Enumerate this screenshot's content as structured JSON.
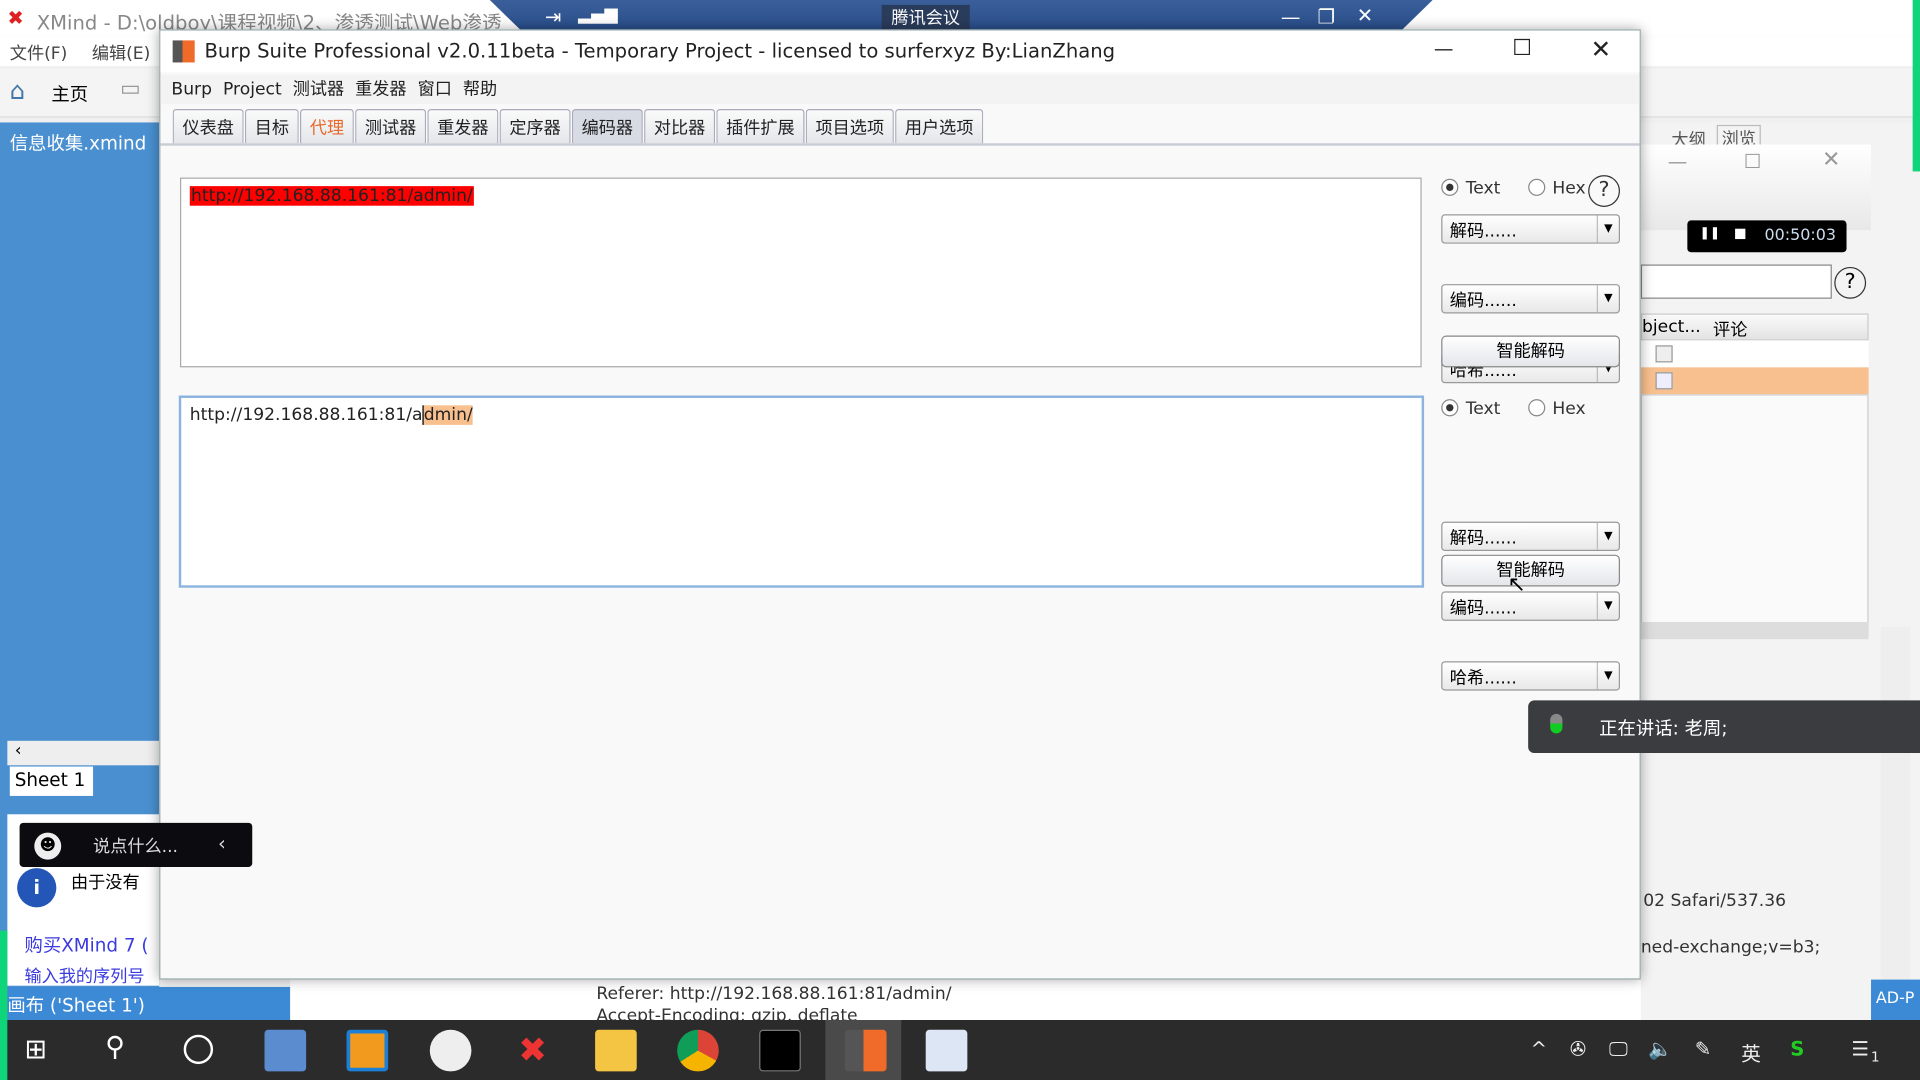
{
  "xmind": {
    "title": "XMind - D:\\oldboy\\课程视频\\2、渗透测试\\Web渗透",
    "menu": [
      "文件(F)",
      "编辑(E)"
    ],
    "home": "主页",
    "file_tab": "信息收集.xmind",
    "sheet_tab": "Sheet 1",
    "status": "画布 ('Sheet 1')",
    "info_text": "由于没有",
    "buy_link": "购买XMind 7 (",
    "serial_link": "输入我的序列号",
    "tabs_right": [
      "大纲",
      "浏览"
    ],
    "col_object": "bject...",
    "col_comment": "评论",
    "req_line1": "02 Safari/537.36",
    "req_line2": "ned-exchange;v=b3;",
    "req_referer": "Referer: http://192.168.88.161:81/admin/",
    "req_encoding": "Accept-Encoding: gzip, deflate",
    "side_label": "AD-P"
  },
  "meeting": {
    "title": "腾讯会议",
    "timer": "00:50:03",
    "speaking": "正在讲话: 老周;",
    "chat_placeholder": "说点什么..."
  },
  "burp": {
    "title": "Burp Suite Professional v2.0.11beta - Temporary Project - licensed to surferxyz By:LianZhang",
    "menu": [
      "Burp",
      "Project",
      "测试器",
      "重发器",
      "窗口",
      "帮助"
    ],
    "tabs": [
      "仪表盘",
      "目标",
      "代理",
      "测试器",
      "重发器",
      "定序器",
      "编码器",
      "对比器",
      "插件扩展",
      "项目选项",
      "用户选项"
    ],
    "selected_tab": "编码器",
    "panels": [
      {
        "text": "http://192.168.88.161:81/admin/",
        "mode": "Text",
        "decode": "解码......",
        "encode": "编码......",
        "hash": "哈希......",
        "smart": "智能解码"
      },
      {
        "text_pre": "http://192.168.88.161:81/a",
        "text_sel": "dmin/",
        "mode": "Text",
        "decode": "解码......",
        "encode": "编码......",
        "hash": "哈希......",
        "smart": "智能解码"
      }
    ],
    "text_label": "Text",
    "hex_label": "Hex",
    "help": "?"
  },
  "taskbar": {
    "ime": "英",
    "notif_count": "1"
  }
}
